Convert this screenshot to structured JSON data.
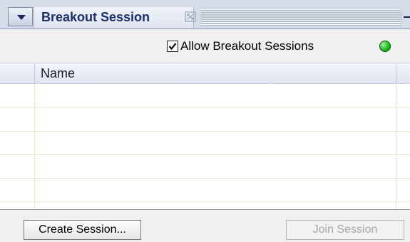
{
  "panel": {
    "title": "Breakout Session",
    "collapse_icon": "triangle-down-icon",
    "float_icon": "float-panel-icon",
    "minimize_icon": "minus-icon"
  },
  "options": {
    "allow_label": "Allow Breakout Sessions",
    "allow_checked": true,
    "status_color": "#2dc02d",
    "status_icon": "green-status-icon"
  },
  "table": {
    "columns": [
      "Name"
    ],
    "rows": [
      "",
      "",
      "",
      "",
      ""
    ]
  },
  "footer": {
    "create_label": "Create Session...",
    "join_label": "Join Session",
    "join_enabled": false
  }
}
